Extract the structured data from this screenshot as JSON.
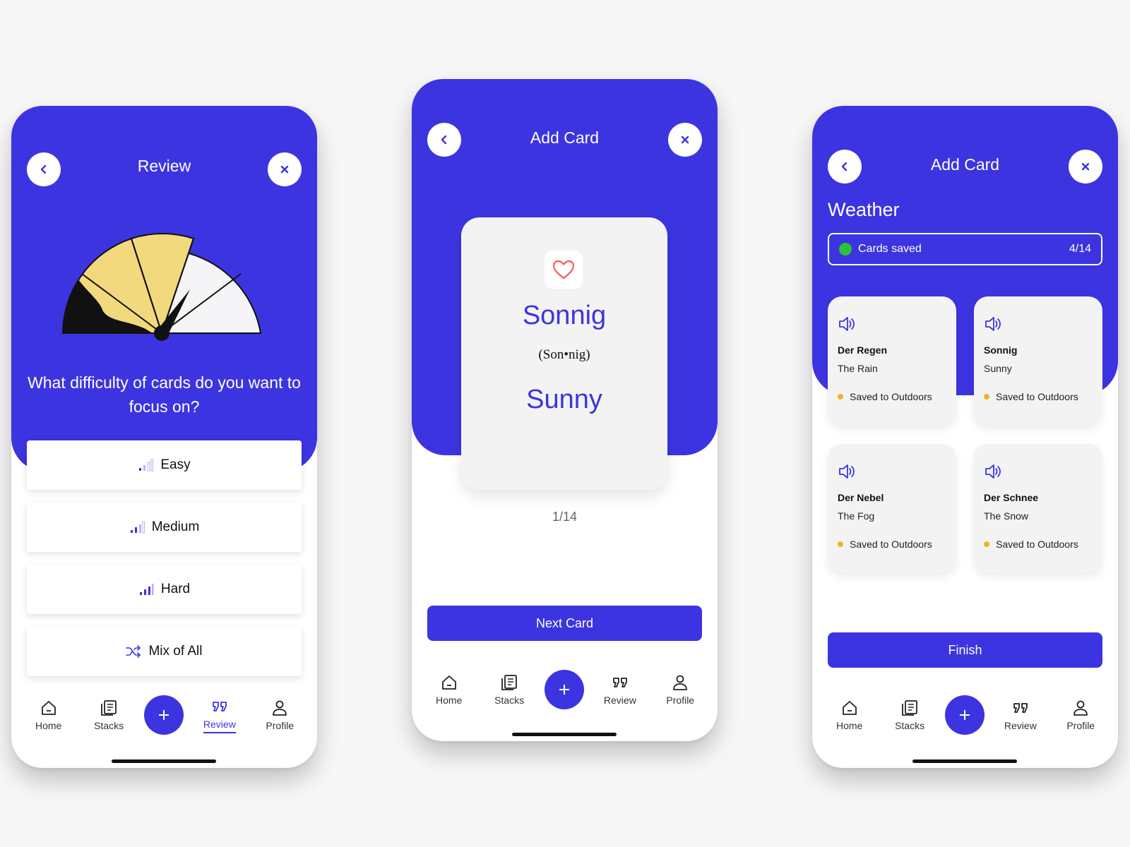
{
  "colors": {
    "primary": "#3c34e0",
    "gauge_yellow": "#f3d97d",
    "gauge_white": "#f5f5f7",
    "saved_green": "#2cc33a",
    "saved_dot": "#f0b326",
    "heart": "#f26a60"
  },
  "nav": {
    "home": "Home",
    "stacks": "Stacks",
    "review": "Review",
    "profile": "Profile",
    "icons": [
      "home-icon",
      "stacks-icon",
      "plus-icon",
      "review-icon",
      "profile-icon"
    ]
  },
  "review_screen": {
    "title": "Review",
    "question": "What difficulty of cards do you want to focus on?",
    "options": [
      {
        "label": "Easy",
        "icon": "signal-low-icon",
        "level": 1
      },
      {
        "label": "Medium",
        "icon": "signal-medium-icon",
        "level": 2
      },
      {
        "label": "Hard",
        "icon": "signal-high-icon",
        "level": 3
      },
      {
        "label": "Mix of All",
        "icon": "shuffle-icon"
      }
    ],
    "active_nav": "Review"
  },
  "add_card_screen": {
    "title": "Add Card",
    "card": {
      "word": "Sonnig",
      "pronunciation": "(Son•nig)",
      "translation": "Sunny",
      "icon": "heart-icon"
    },
    "counter": "1/14",
    "next_label": "Next Card"
  },
  "saved_screen": {
    "title": "Add Card",
    "stack_name": "Weather",
    "saved_label": "Cards saved",
    "saved_count": "4/14",
    "cards": [
      {
        "de": "Der Regen",
        "en": "The Rain",
        "status": "Saved to Outdoors"
      },
      {
        "de": "Sonnig",
        "en": "Sunny",
        "status": "Saved to Outdoors"
      },
      {
        "de": "Der Nebel",
        "en": "The Fog",
        "status": "Saved to Outdoors"
      },
      {
        "de": "Der Schnee",
        "en": "The Snow",
        "status": "Saved to Outdoors"
      }
    ],
    "finish_label": "Finish"
  }
}
